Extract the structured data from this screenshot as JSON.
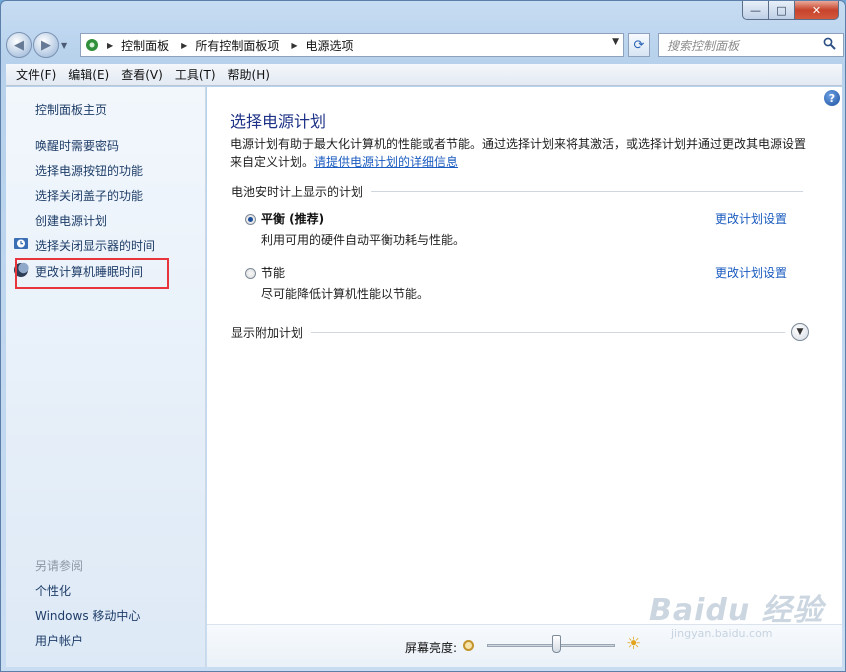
{
  "window": {
    "caption": {
      "minimize": "—",
      "maximize": "□",
      "close": "✕"
    }
  },
  "nav": {
    "back_glyph": "◀",
    "forward_glyph": "▶",
    "breadcrumbs": [
      "控制面板",
      "所有控制面板项",
      "电源选项"
    ],
    "search_placeholder": "搜索控制面板"
  },
  "menu": [
    "文件(F)",
    "编辑(E)",
    "查看(V)",
    "工具(T)",
    "帮助(H)"
  ],
  "sidebar": {
    "home": "控制面板主页",
    "links": [
      "唤醒时需要密码",
      "选择电源按钮的功能",
      "选择关闭盖子的功能",
      "创建电源计划",
      "选择关闭显示器的时间",
      "更改计算机睡眠时间"
    ],
    "see_also_title": "另请参阅",
    "see_also": [
      "个性化",
      "Windows 移动中心",
      "用户帐户"
    ]
  },
  "main": {
    "title": "选择电源计划",
    "intro": "电源计划有助于最大化计算机的性能或者节能。通过选择计划来将其激活，或选择计划并通过更改其电源设置来自定义计划。",
    "intro_link": "请提供电源计划的详细信息",
    "group_battery": "电池安时计上显示的计划",
    "plans": [
      {
        "name": "平衡 (推荐)",
        "desc": "利用可用的硬件自动平衡功耗与性能。",
        "link": "更改计划设置",
        "selected": true
      },
      {
        "name": "节能",
        "desc": "尽可能降低计算机性能以节能。",
        "link": "更改计划设置",
        "selected": false
      }
    ],
    "group_additional": "显示附加计划",
    "help_glyph": "?"
  },
  "bottom": {
    "brightness_label": "屏幕亮度:",
    "brightness_level": 0.54
  },
  "watermark": {
    "main": "Baidu 经验",
    "sub": "jingyan.baidu.com"
  },
  "colors": {
    "link": "#1a5bbf",
    "title": "#1e3287",
    "highlight": "#e8353b"
  }
}
